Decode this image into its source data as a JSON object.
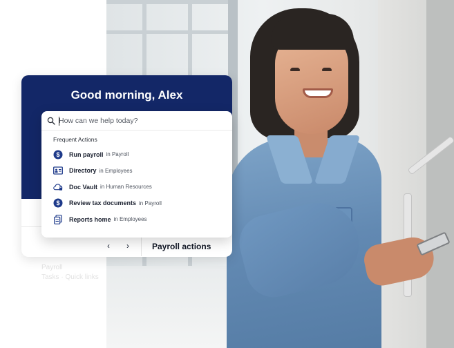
{
  "card": {
    "greeting": "Good morning, Alex",
    "payroll_actions_label": "Payroll actions",
    "prev_arrow": "‹",
    "next_arrow": "›"
  },
  "search": {
    "placeholder": "How can we help today?",
    "value": ""
  },
  "frequent_actions": {
    "label": "Frequent Actions",
    "items": [
      {
        "name": "Run payroll",
        "context": "in Payroll",
        "icon": "dollar-circle-icon"
      },
      {
        "name": "Directory",
        "context": "in Employees",
        "icon": "id-card-icon"
      },
      {
        "name": "Doc Vault",
        "context": "in Human Resources",
        "icon": "cloud-lock-icon"
      },
      {
        "name": "Review tax documents",
        "context": "in Payroll",
        "icon": "dollar-circle-icon"
      },
      {
        "name": "Reports home",
        "context": "in Employees",
        "icon": "document-icon"
      }
    ]
  },
  "ghost_text": {
    "line1": "Payroll",
    "line2": "Tasks · Quick links"
  },
  "colors": {
    "header_navy": "#132767",
    "icon_navy": "#1e3a8a",
    "text_dark": "#1b2130"
  }
}
